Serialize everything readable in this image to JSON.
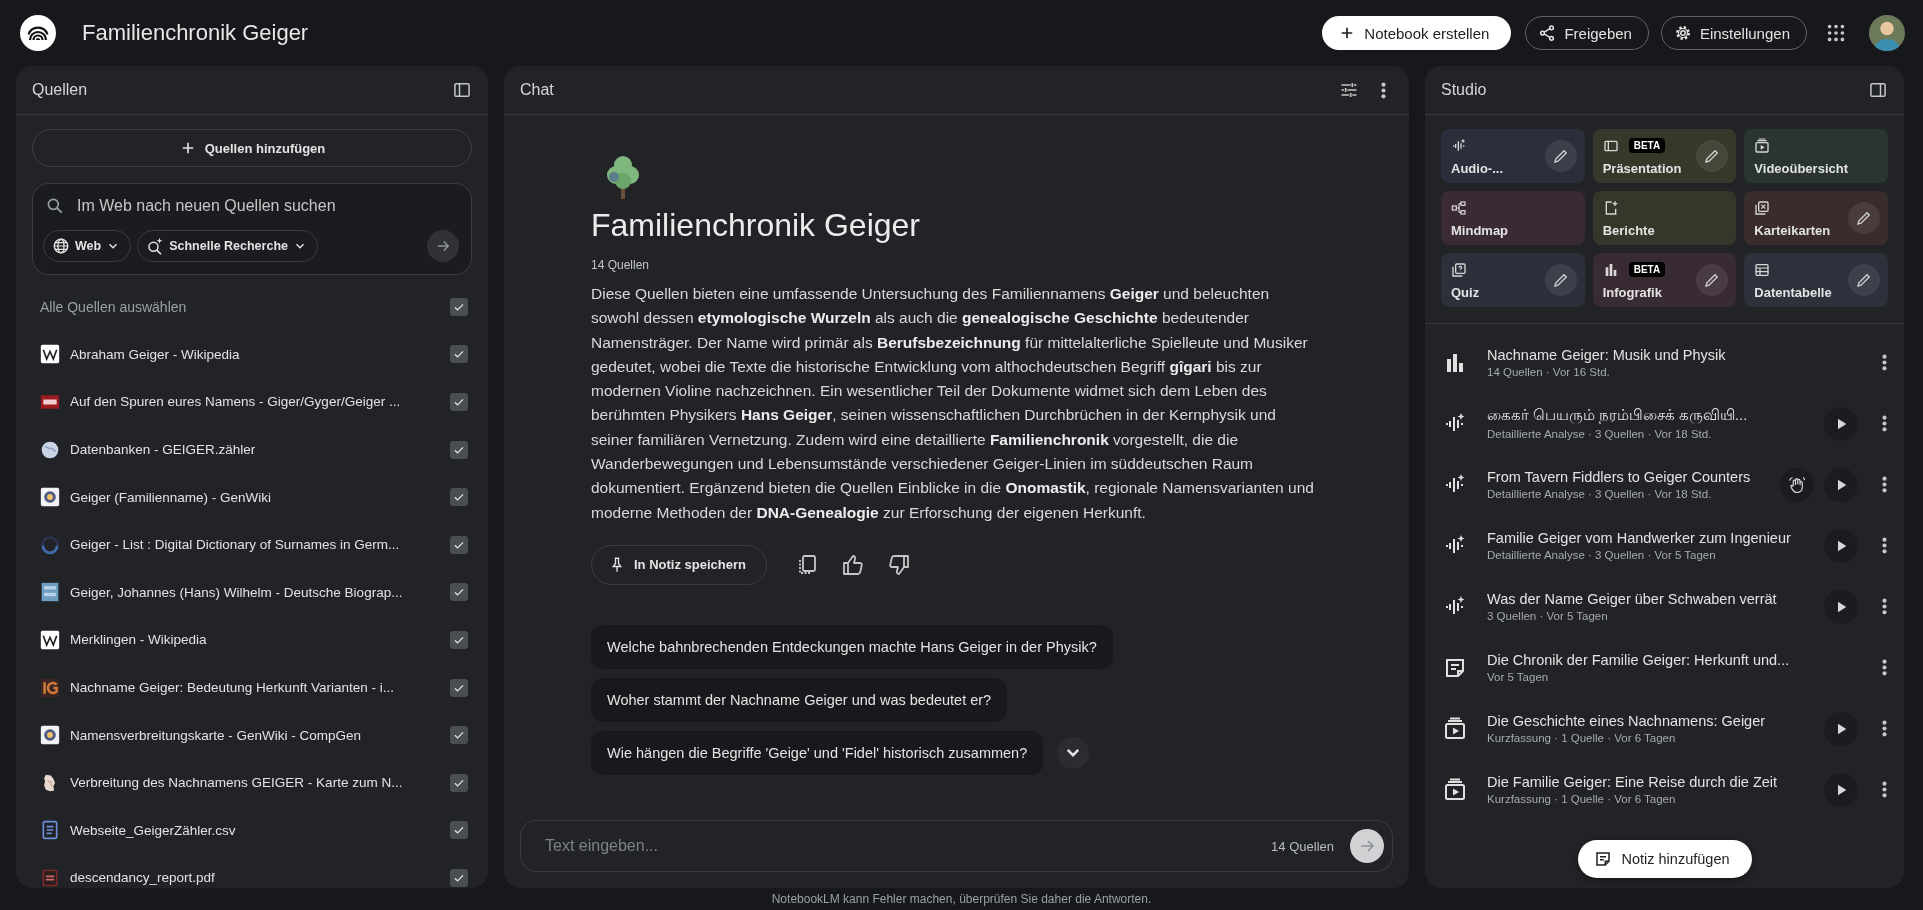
{
  "app": {
    "title": "Familienchronik Geiger"
  },
  "header_actions": [
    {
      "kind": "create",
      "label": "Notebook erstellen"
    },
    {
      "kind": "share",
      "label": "Freigeben"
    },
    {
      "kind": "settings",
      "label": "Einstellungen"
    }
  ],
  "sources_panel": {
    "title": "Quellen",
    "add_button": "Quellen hinzufügen",
    "search": {
      "placeholder": "Im Web nach neuen Quellen suchen",
      "chips": [
        {
          "kind": "web",
          "label": "Web"
        },
        {
          "kind": "research",
          "label": "Schnelle Recherche"
        }
      ]
    },
    "select_all": {
      "label": "Alle Quellen auswählen",
      "checked": true
    },
    "sources": [
      {
        "kind": "wiki",
        "title": "Abraham Geiger - Wikipedia",
        "checked": true
      },
      {
        "kind": "srf",
        "title": "Auf den Spuren eures Namens - Giger/Gyger/Geiger ...",
        "checked": true
      },
      {
        "kind": "globe",
        "title": "Datenbanken - GEIGER.zähler",
        "checked": true
      },
      {
        "kind": "genwiki",
        "title": "Geiger (Familienname) - GenWiki",
        "checked": true
      },
      {
        "kind": "ring",
        "title": "Geiger - List : Digital Dictionary of Surnames in Germ...",
        "checked": true
      },
      {
        "kind": "debio",
        "title": "Geiger, Johannes (Hans) Wilhelm - Deutsche Biograp...",
        "checked": true
      },
      {
        "kind": "wiki",
        "title": "Merklingen - Wikipedia",
        "checked": true
      },
      {
        "kind": "ig",
        "title": "Nachname Geiger: Bedeutung Herkunft Varianten - i...",
        "checked": true
      },
      {
        "kind": "genwiki",
        "title": "Namensverbreitungskarte - GenWiki - CompGen",
        "checked": true
      },
      {
        "kind": "map",
        "title": "Verbreitung des Nachnamens GEIGER - Karte zum N...",
        "checked": true
      },
      {
        "kind": "doc",
        "title": "Webseite_GeigerZähler.csv",
        "checked": true
      },
      {
        "kind": "pdf",
        "title": "descendancy_report.pdf",
        "checked": true
      }
    ]
  },
  "chat_panel": {
    "title": "Chat",
    "overview": {
      "title": "Familienchronik Geiger",
      "source_count": "14 Quellen",
      "summary": "Diese Quellen bieten eine umfassende Untersuchung des Familiennamens **Geiger** und beleuchten sowohl dessen **etymologische Wurzeln** als auch die **genealogische Geschichte** bedeutender Namensträger. Der Name wird primär als **Berufsbezeichnung** für mittelalterliche Spielleute und Musiker gedeutet, wobei die Texte die historische Entwicklung vom althochdeutschen Begriff **gîgari** bis zur modernen Violine nachzeichnen. Ein wesentlicher Teil der Dokumente widmet sich dem Leben des berühmten Physikers **Hans Geiger**, seinen wissenschaftlichen Durchbrüchen in der Kernphysik und seiner familiären Vernetzung. Zudem wird eine detaillierte **Familienchronik** vorgestellt, die die Wanderbewegungen und Lebensumstände verschiedener Geiger-Linien im süddeutschen Raum dokumentiert. Ergänzend bieten die Quellen Einblicke in die **Onomastik**, regionale Namensvarianten und moderne Methoden der **DNA-Genealogie** zur Erforschung der eigenen Herkunft.",
      "save_button": "In Notiz speichern"
    },
    "suggestions": [
      "Welche bahnbrechenden Entdeckungen machte Hans Geiger in der Physik?",
      "Woher stammt der Nachname Geiger und was bedeutet er?",
      "Wie hängen die Begriffe 'Geige' und 'Fidel' historisch zusammen?"
    ],
    "input": {
      "placeholder": "Text eingeben...",
      "source_count": "14 Quellen"
    }
  },
  "studio_panel": {
    "title": "Studio",
    "tools": [
      {
        "kind": "audio",
        "label": "Audio-...",
        "editable": true,
        "color": "#2b2f3b"
      },
      {
        "kind": "slides",
        "label": "Präsentation",
        "badge": "BETA",
        "editable": true,
        "color": "#37382a"
      },
      {
        "kind": "video",
        "label": "Videoübersicht",
        "editable": false,
        "color": "#2b3530"
      },
      {
        "kind": "mindmap",
        "label": "Mindmap",
        "editable": false,
        "color": "#3a2a33"
      },
      {
        "kind": "report",
        "label": "Berichte",
        "editable": false,
        "color": "#36372a"
      },
      {
        "kind": "cards",
        "label": "Karteikarten",
        "editable": true,
        "color": "#3a2c2b"
      },
      {
        "kind": "quiz",
        "label": "Quiz",
        "editable": true,
        "color": "#2c303b"
      },
      {
        "kind": "infographic",
        "label": "Infografik",
        "badge": "BETA",
        "editable": true,
        "color": "#392b33"
      },
      {
        "kind": "table",
        "label": "Datentabelle",
        "editable": true,
        "color": "#2d313c"
      }
    ],
    "items": [
      {
        "kind": "chart",
        "title": "Nachname Geiger: Musik und Physik",
        "subtitle": "14 Quellen · Vor 16 Std.",
        "playable": false,
        "interactive": false
      },
      {
        "kind": "audio",
        "title": "கைகர் பெயரும் நரம்பிசைக் கருவியி...",
        "subtitle": "Detaillierte Analyse · 3 Quellen · Vor 18 Std.",
        "playable": true,
        "interactive": false
      },
      {
        "kind": "audio",
        "title": "From Tavern Fiddlers to Geiger Counters",
        "subtitle": "Detaillierte Analyse · 3 Quellen · Vor 18 Std.",
        "playable": true,
        "interactive": true
      },
      {
        "kind": "audio",
        "title": "Familie Geiger vom Handwerker zum Ingenieur",
        "subtitle": "Detaillierte Analyse · 3 Quellen · Vor 5 Tagen",
        "playable": true,
        "interactive": false
      },
      {
        "kind": "audio",
        "title": "Was der Name Geiger über Schwaben verrät",
        "subtitle": "3 Quellen · Vor 5 Tagen",
        "playable": true,
        "interactive": false
      },
      {
        "kind": "note",
        "title": "Die Chronik der Familie Geiger: Herkunft und...",
        "subtitle": "Vor 5 Tagen",
        "playable": false,
        "interactive": false
      },
      {
        "kind": "video",
        "title": "Die Geschichte eines Nachnamens: Geiger",
        "subtitle": "Kurzfassung · 1 Quelle · Vor 6 Tagen",
        "playable": true,
        "interactive": false
      },
      {
        "kind": "video",
        "title": "Die Familie Geiger: Eine Reise durch die Zeit",
        "subtitle": "Kurzfassung · 1 Quelle · Vor 6 Tagen",
        "playable": true,
        "interactive": false
      }
    ],
    "add_note_button": "Notiz hinzufügen"
  },
  "footer": "NotebookLM kann Fehler machen, überprüfen Sie daher die Antworten."
}
